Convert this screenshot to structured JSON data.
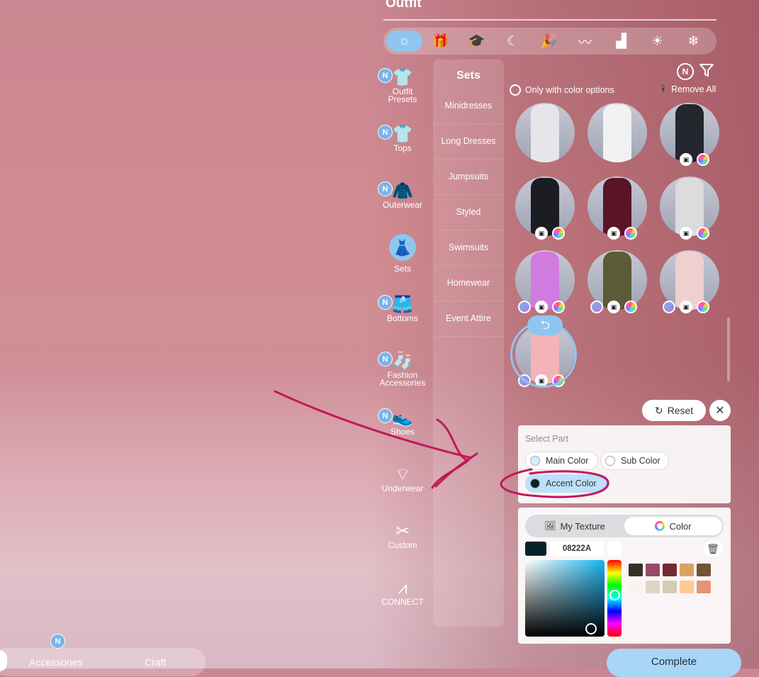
{
  "header": {
    "title": "Outfit"
  },
  "filter_tabs": [
    {
      "icon": "sun-moon-icon",
      "glyph": "☼",
      "active": true
    },
    {
      "icon": "gift-icon",
      "glyph": "🎁"
    },
    {
      "icon": "graduation-cap-icon",
      "glyph": "🎓"
    },
    {
      "icon": "sleep-moon-icon",
      "glyph": "☾"
    },
    {
      "icon": "party-popper-icon",
      "glyph": "🎉"
    },
    {
      "icon": "swimming-icon",
      "glyph": "〰"
    },
    {
      "icon": "factory-icon",
      "glyph": "▟"
    },
    {
      "icon": "sun-icon",
      "glyph": "☀"
    },
    {
      "icon": "snowflake-icon",
      "glyph": "❄"
    }
  ],
  "categories": [
    {
      "label": "Outfit\nPresets",
      "line1": "Outfit",
      "line2": "Presets",
      "badge": "N",
      "icon": "outfit-presets-icon",
      "glyph": "👕"
    },
    {
      "label": "Tops",
      "badge": "N",
      "icon": "tshirt-icon",
      "glyph": "👕"
    },
    {
      "label": "Outerwear",
      "badge": "N",
      "icon": "jacket-icon",
      "glyph": "🧥"
    },
    {
      "label": "Sets",
      "icon": "dress-icon",
      "glyph": "👗"
    },
    {
      "label": "Bottoms",
      "badge": "N",
      "icon": "shorts-icon",
      "glyph": "🩳"
    },
    {
      "label": "Fashion Accessories",
      "line1": "Fashion",
      "line2": "Accessories",
      "badge": "N",
      "icon": "sock-icon",
      "glyph": "🧦"
    },
    {
      "label": "Shoes",
      "badge": "N",
      "icon": "sneaker-icon",
      "glyph": "👟"
    },
    {
      "label": "Underwear",
      "icon": "underwear-icon",
      "glyph": "⌔"
    },
    {
      "label": "Custom",
      "icon": "scissors-icon",
      "glyph": "✂"
    },
    {
      "label": "CONNECT",
      "icon": "connect-logo-icon",
      "glyph": "⩘"
    }
  ],
  "sets_panel": {
    "heading": "Sets",
    "subcategories": [
      "Minidresses",
      "Long Dresses",
      "Jumpsuits",
      "Styled",
      "Swimsuits",
      "Homewear",
      "Event Attire"
    ]
  },
  "grid": {
    "n_badge": "N",
    "color_option_label": "Only with color options",
    "remove_all_label": "Remove All"
  },
  "items": [
    {
      "fig_color": "#e6e6ea",
      "badges": []
    },
    {
      "fig_color": "#f1f1f3",
      "badges": []
    },
    {
      "fig_color": "#23262c",
      "badges": [
        "img",
        "col"
      ]
    },
    {
      "fig_color": "#1b1d22",
      "badges": [
        "img",
        "col"
      ]
    },
    {
      "fig_color": "#5a1428",
      "badges": [
        "img",
        "col"
      ]
    },
    {
      "fig_color": "#dcdcdf",
      "badges": [
        "img",
        "col"
      ]
    },
    {
      "fig_color": "#d07be0",
      "badges": [
        "mp",
        "img",
        "col"
      ]
    },
    {
      "fig_color": "#5a5b37",
      "badges": [
        "mp",
        "img",
        "col"
      ]
    },
    {
      "fig_color": "#f0cfcf",
      "badges": [
        "mp",
        "img",
        "col"
      ]
    },
    {
      "fig_color": "#f2b3b9",
      "badges": [
        "mp",
        "img",
        "col"
      ],
      "selected": true
    }
  ],
  "undo_glyph": "⮌",
  "editor": {
    "reset_label": "Reset",
    "reset_glyph": "↻",
    "close_glyph": "✕",
    "select_part_label": "Select Part",
    "parts": [
      {
        "label": "Main Color",
        "swatch": "#d6ecf8"
      },
      {
        "label": "Sub Color",
        "swatch": "#ffffff"
      },
      {
        "label": "Accent Color",
        "swatch": "#08222A",
        "selected": true
      }
    ],
    "texture_tab_label": "My Texture",
    "color_tab_label": "Color",
    "current_hex": "08222A",
    "current_color": "#08222A",
    "palette": [
      "#3a2f25",
      "#964a66",
      "#742a31",
      "#d8a263",
      "#725534",
      "#fdf0f0",
      "#dfd4c6",
      "#d2ccb2",
      "#ffc996",
      "#e69376"
    ],
    "trash_glyph": "🗑"
  },
  "complete_label": "Complete",
  "bottom_bar": {
    "accessories_label": "Accessories",
    "accessories_badge": "N",
    "craft_label": "Craft"
  }
}
